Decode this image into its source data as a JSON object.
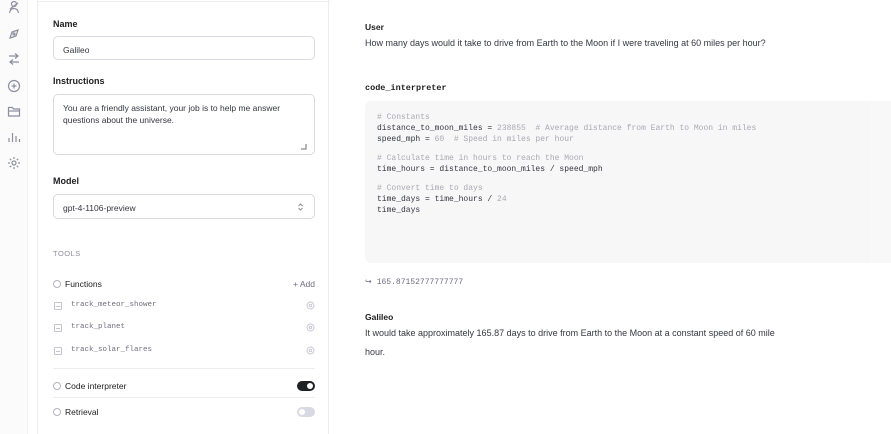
{
  "rail": {
    "icons": [
      "assistant-icon",
      "playground-icon",
      "compare-icon",
      "threads-icon",
      "files-icon",
      "usage-icon",
      "settings-icon"
    ]
  },
  "assistant": {
    "name_label": "Name",
    "name_value": "Galileo",
    "instructions_label": "Instructions",
    "instructions_value": "You are a friendly assistant, your job is to help me answer questions about the universe.",
    "model_label": "Model",
    "model_value": "gpt-4-1106-preview",
    "tools_header": "TOOLS",
    "functions_label": "Functions",
    "add_label": "+ Add",
    "functions": [
      {
        "name": "track_meteor_shower"
      },
      {
        "name": "track_planet"
      },
      {
        "name": "track_solar_flares"
      }
    ],
    "code_interpreter_label": "Code interpreter",
    "code_interpreter_enabled": true,
    "retrieval_label": "Retrieval",
    "retrieval_enabled": false
  },
  "conversation": {
    "user_label": "User",
    "user_message": "How many days would it take to drive from Earth to the Moon if I were traveling at 60 miles per hour?",
    "tool_label": "code_interpreter",
    "code": {
      "c1": "# Constants",
      "l1a": "distance_to_moon_miles = ",
      "l1n": "238855",
      "l1c": "  # Average distance from Earth to Moon in miles",
      "l2a": "speed_mph = ",
      "l2n": "60",
      "l2c": "  # Speed in miles per hour",
      "c2": "# Calculate time in hours to reach the Moon",
      "l3": "time_hours = distance_to_moon_miles / speed_mph",
      "c3": "# Convert time to days",
      "l4a": "time_days = time_hours / ",
      "l4n": "24",
      "l5": "time_days"
    },
    "output_arrow": "↪",
    "output_value": "165.87152777777777",
    "assistant_label": "Galileo",
    "assistant_message_1": "It would take approximately 165.87 days to drive from Earth to the Moon at a constant speed of 60 mile",
    "assistant_message_2": "hour."
  }
}
